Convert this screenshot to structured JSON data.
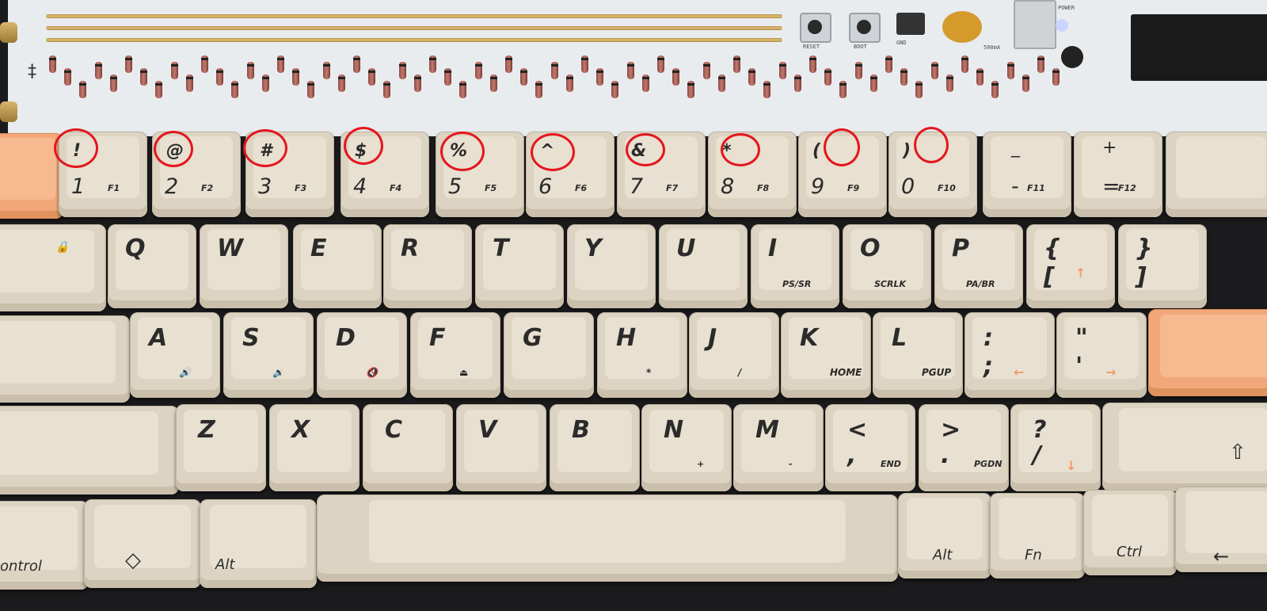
{
  "pcb": {
    "labels": {
      "reset": "RESET",
      "boot": "BOOT",
      "gnd": "GND",
      "current": "500mA",
      "power": "POWER"
    },
    "colors": {
      "board": "#e9ecef",
      "gold": "#c9a55d",
      "diode": "#a85f55"
    }
  },
  "keyboard": {
    "colors": {
      "keycap": "#dcd3c2",
      "accent": "#f2a77a",
      "annotation": "#e3161e"
    },
    "number_row": [
      {
        "shift": "!",
        "main": "1",
        "fn": "F1"
      },
      {
        "shift": "@",
        "main": "2",
        "fn": "F2"
      },
      {
        "shift": "#",
        "main": "3",
        "fn": "F3"
      },
      {
        "shift": "$",
        "main": "4",
        "fn": "F4"
      },
      {
        "shift": "%",
        "main": "5",
        "fn": "F5"
      },
      {
        "shift": "^",
        "main": "6",
        "fn": "F6"
      },
      {
        "shift": "&",
        "main": "7",
        "fn": "F7"
      },
      {
        "shift": "*",
        "main": "8",
        "fn": "F8"
      },
      {
        "shift": "(",
        "main": "9",
        "fn": "F9"
      },
      {
        "shift": ")",
        "main": "0",
        "fn": "F10"
      },
      {
        "shift": "_",
        "main": "-",
        "fn": "F11"
      },
      {
        "shift": "+",
        "main": "=",
        "fn": "F12"
      }
    ],
    "qwerty_row": [
      {
        "main": "Q",
        "sub": ""
      },
      {
        "main": "W",
        "sub": ""
      },
      {
        "main": "E",
        "sub": ""
      },
      {
        "main": "R",
        "sub": ""
      },
      {
        "main": "T",
        "sub": ""
      },
      {
        "main": "Y",
        "sub": ""
      },
      {
        "main": "U",
        "sub": ""
      },
      {
        "main": "I",
        "sub": "PS/SR"
      },
      {
        "main": "O",
        "sub": "SCRLK"
      },
      {
        "main": "P",
        "sub": "PA/BR"
      },
      {
        "main": "{",
        "lower": "[",
        "sub": "↑"
      },
      {
        "main": "}",
        "lower": "]",
        "sub": ""
      }
    ],
    "home_row": [
      {
        "main": "A",
        "sub": "🔊"
      },
      {
        "main": "S",
        "sub": "🔉"
      },
      {
        "main": "D",
        "sub": "🔇"
      },
      {
        "main": "F",
        "sub": "⏏"
      },
      {
        "main": "G",
        "sub": ""
      },
      {
        "main": "H",
        "sub": "*"
      },
      {
        "main": "J",
        "sub": "/"
      },
      {
        "main": "K",
        "sub": "HOME"
      },
      {
        "main": "L",
        "sub": "PGUP"
      },
      {
        "main": ":",
        "lower": ";",
        "sub": "←"
      },
      {
        "main": "\"",
        "lower": "'",
        "sub": "→"
      }
    ],
    "bottom_alpha_row": [
      {
        "main": "Z",
        "sub": ""
      },
      {
        "main": "X",
        "sub": ""
      },
      {
        "main": "C",
        "sub": ""
      },
      {
        "main": "V",
        "sub": ""
      },
      {
        "main": "B",
        "sub": ""
      },
      {
        "main": "N",
        "sub": "+"
      },
      {
        "main": "M",
        "sub": "-"
      },
      {
        "main": "<",
        "lower": ",",
        "sub": "END"
      },
      {
        "main": ">",
        "lower": ".",
        "sub": "PGDN"
      },
      {
        "main": "?",
        "lower": "/",
        "sub": "↓"
      }
    ],
    "mod_row": {
      "control": "ontrol",
      "meta": "◇",
      "alt_left": "Alt",
      "alt_right": "Alt",
      "fn": "Fn",
      "ctrl": "Ctrl",
      "arrow": "←"
    },
    "tab_lock_glyph": "🔒",
    "shift_glyph": "⇧"
  }
}
